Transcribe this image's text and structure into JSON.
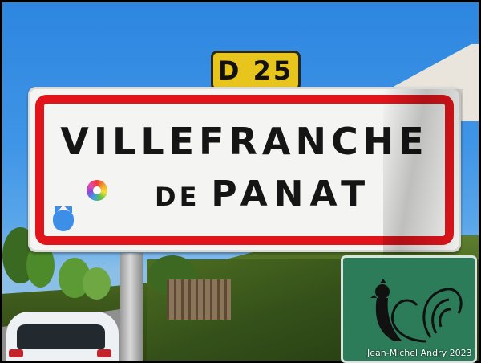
{
  "route_sign": {
    "text": "D 25"
  },
  "town_sign": {
    "line1": "VILLEFRANCHE",
    "line2_prefix": "DE",
    "line2_name": "PANAT"
  },
  "credit": "Jean-Michel Andry 2023",
  "colors": {
    "sign_border": "#e2141b",
    "sign_background": "#f4f4f2",
    "route_plate": "#e8c51c",
    "green_sign": "#2c7c5a",
    "sky": "#2d86e0"
  },
  "icons": [
    "flower-sticker-icon",
    "cat-sticker-icon",
    "rooster-icon"
  ]
}
